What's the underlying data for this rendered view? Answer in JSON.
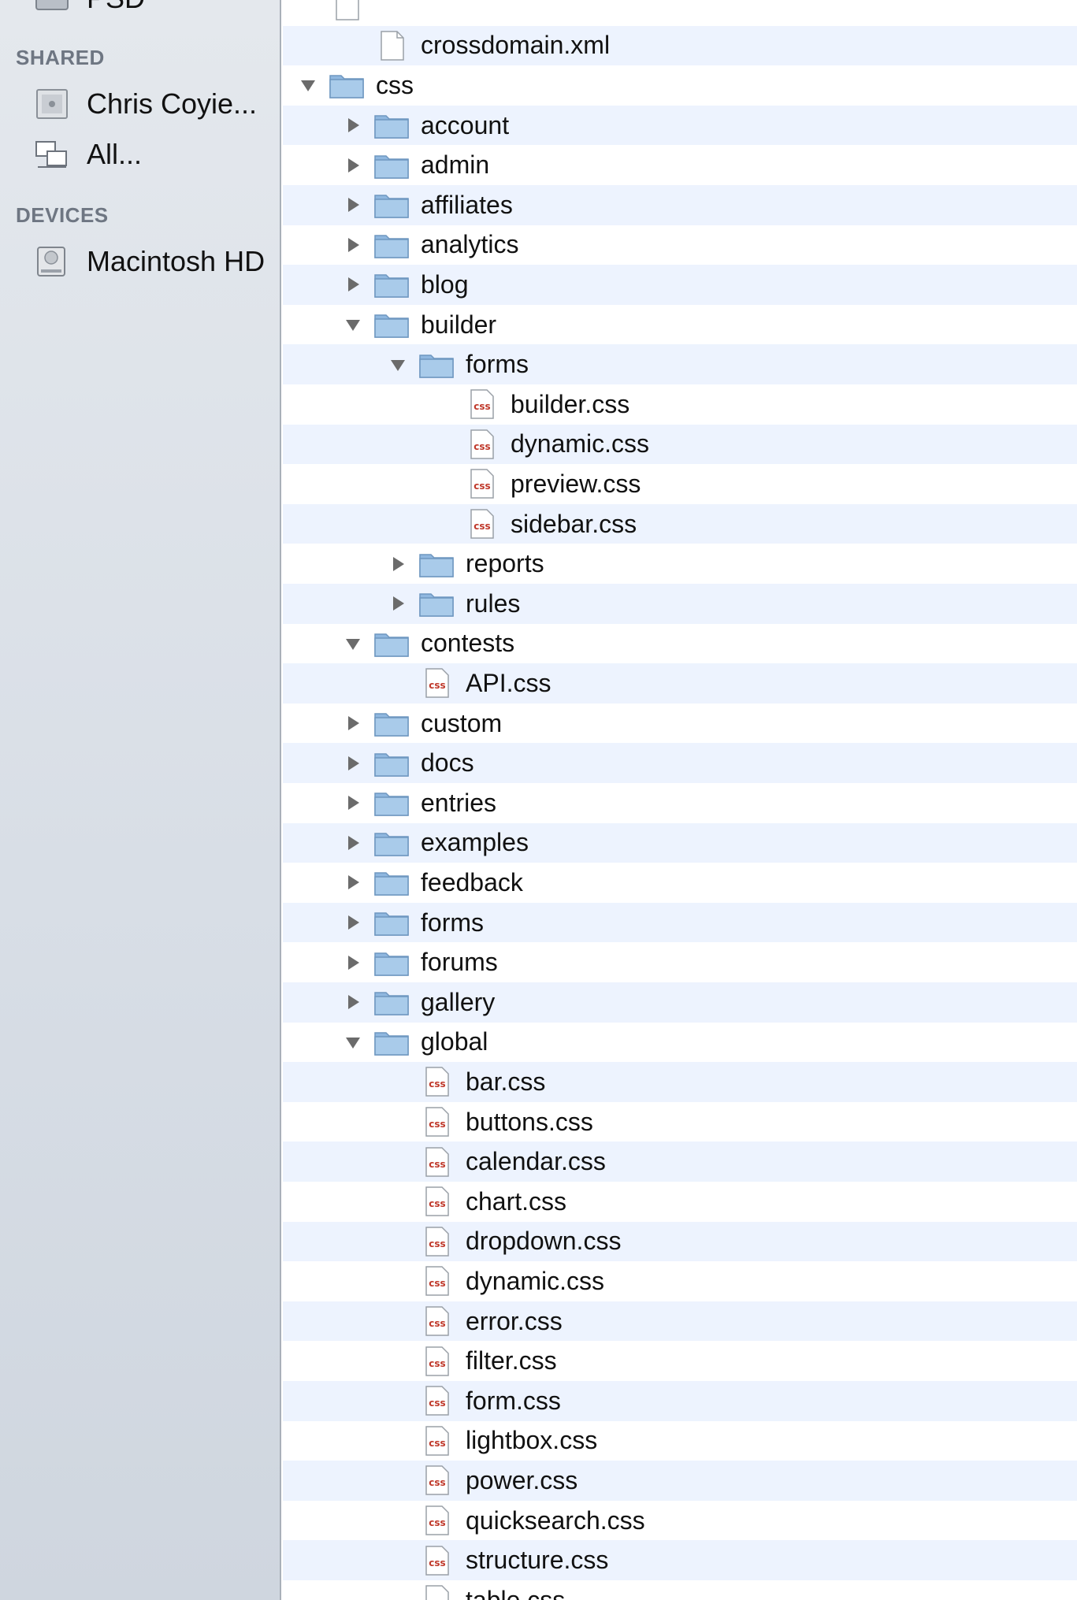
{
  "sidebar": {
    "partial_item": {
      "label": "PSD",
      "icon": "drive-icon"
    },
    "sections": [
      {
        "title": "SHARED",
        "items": [
          {
            "label": "Chris Coyie...",
            "icon": "shared-computer-icon"
          },
          {
            "label": "All...",
            "icon": "network-icon"
          }
        ]
      },
      {
        "title": "DEVICES",
        "items": [
          {
            "label": "Macintosh HD",
            "icon": "hard-drive-icon"
          }
        ]
      }
    ]
  },
  "files": [
    {
      "name": "",
      "depth": 0,
      "type": "file",
      "partial": true
    },
    {
      "name": "crossdomain.xml",
      "depth": 1,
      "type": "file"
    },
    {
      "name": "css",
      "depth": 0,
      "type": "folder",
      "state": "expanded"
    },
    {
      "name": "account",
      "depth": 1,
      "type": "folder",
      "state": "collapsed"
    },
    {
      "name": "admin",
      "depth": 1,
      "type": "folder",
      "state": "collapsed"
    },
    {
      "name": "affiliates",
      "depth": 1,
      "type": "folder",
      "state": "collapsed"
    },
    {
      "name": "analytics",
      "depth": 1,
      "type": "folder",
      "state": "collapsed"
    },
    {
      "name": "blog",
      "depth": 1,
      "type": "folder",
      "state": "collapsed"
    },
    {
      "name": "builder",
      "depth": 1,
      "type": "folder",
      "state": "expanded"
    },
    {
      "name": "forms",
      "depth": 2,
      "type": "folder",
      "state": "expanded"
    },
    {
      "name": "builder.css",
      "depth": 3,
      "type": "css"
    },
    {
      "name": "dynamic.css",
      "depth": 3,
      "type": "css"
    },
    {
      "name": "preview.css",
      "depth": 3,
      "type": "css"
    },
    {
      "name": "sidebar.css",
      "depth": 3,
      "type": "css"
    },
    {
      "name": "reports",
      "depth": 2,
      "type": "folder",
      "state": "collapsed"
    },
    {
      "name": "rules",
      "depth": 2,
      "type": "folder",
      "state": "collapsed"
    },
    {
      "name": "contests",
      "depth": 1,
      "type": "folder",
      "state": "expanded"
    },
    {
      "name": "API.css",
      "depth": 2,
      "type": "css"
    },
    {
      "name": "custom",
      "depth": 1,
      "type": "folder",
      "state": "collapsed"
    },
    {
      "name": "docs",
      "depth": 1,
      "type": "folder",
      "state": "collapsed"
    },
    {
      "name": "entries",
      "depth": 1,
      "type": "folder",
      "state": "collapsed"
    },
    {
      "name": "examples",
      "depth": 1,
      "type": "folder",
      "state": "collapsed"
    },
    {
      "name": "feedback",
      "depth": 1,
      "type": "folder",
      "state": "collapsed"
    },
    {
      "name": "forms",
      "depth": 1,
      "type": "folder",
      "state": "collapsed"
    },
    {
      "name": "forums",
      "depth": 1,
      "type": "folder",
      "state": "collapsed"
    },
    {
      "name": "gallery",
      "depth": 1,
      "type": "folder",
      "state": "collapsed"
    },
    {
      "name": "global",
      "depth": 1,
      "type": "folder",
      "state": "expanded"
    },
    {
      "name": "bar.css",
      "depth": 2,
      "type": "css"
    },
    {
      "name": "buttons.css",
      "depth": 2,
      "type": "css"
    },
    {
      "name": "calendar.css",
      "depth": 2,
      "type": "css"
    },
    {
      "name": "chart.css",
      "depth": 2,
      "type": "css"
    },
    {
      "name": "dropdown.css",
      "depth": 2,
      "type": "css"
    },
    {
      "name": "dynamic.css",
      "depth": 2,
      "type": "css"
    },
    {
      "name": "error.css",
      "depth": 2,
      "type": "css"
    },
    {
      "name": "filter.css",
      "depth": 2,
      "type": "css"
    },
    {
      "name": "form.css",
      "depth": 2,
      "type": "css"
    },
    {
      "name": "lightbox.css",
      "depth": 2,
      "type": "css"
    },
    {
      "name": "power.css",
      "depth": 2,
      "type": "css"
    },
    {
      "name": "quicksearch.css",
      "depth": 2,
      "type": "css"
    },
    {
      "name": "structure.css",
      "depth": 2,
      "type": "css"
    },
    {
      "name": "table.css",
      "depth": 2,
      "type": "css"
    }
  ],
  "colors": {
    "folder_body": "#a9cbea",
    "folder_tab": "#8fb7df",
    "css_badge": "#c0392b",
    "disclosure": "#6b6b6b",
    "stripe": "#edf3fe"
  }
}
